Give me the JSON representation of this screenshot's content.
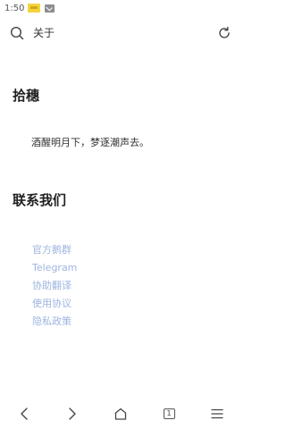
{
  "status_bar": {
    "time": "1:50"
  },
  "top_bar": {
    "title": "关于",
    "search_icon": "search-icon",
    "refresh_icon": "refresh-icon"
  },
  "about": {
    "title": "拾穗",
    "text": "酒醒明月下，梦逐潮声去。"
  },
  "contact": {
    "title": "联系我们",
    "links": [
      "官方鹅群",
      "Telegram",
      "协助翻译",
      "使用协议",
      "隐私政策"
    ]
  },
  "bottom_nav": {
    "tab_count": "1",
    "icons": [
      "back-icon",
      "forward-icon",
      "home-icon",
      "tabs-icon",
      "menu-icon"
    ]
  },
  "colors": {
    "link": "#9db5e0",
    "text": "#333333",
    "background": "#ffffff"
  }
}
